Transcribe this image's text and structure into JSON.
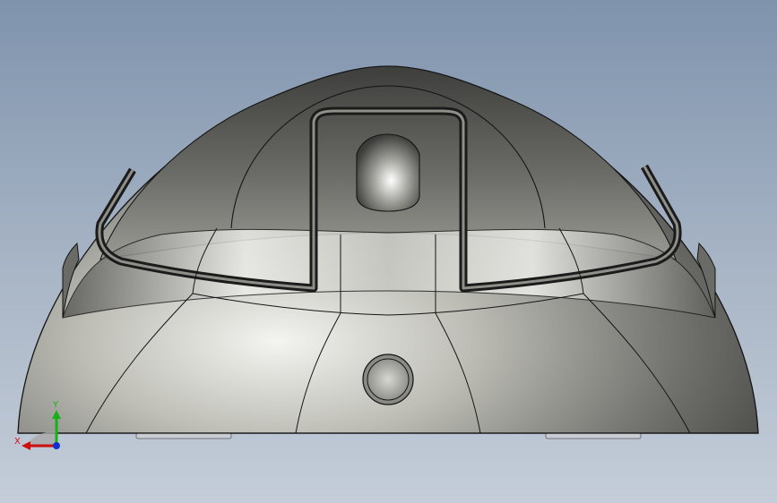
{
  "viewport": {
    "model": "dome-shell"
  },
  "triad": {
    "x_label": "X",
    "y_label": "Y",
    "x_color": "#d01010",
    "y_color": "#18b018",
    "z_color": "#1030d0"
  },
  "colors": {
    "background_top": "#7f93ad",
    "background_bottom": "#c4cdd9",
    "edge": "#141414",
    "metal_light": "#e6e6e2",
    "metal_dark": "#4c4c4a"
  }
}
